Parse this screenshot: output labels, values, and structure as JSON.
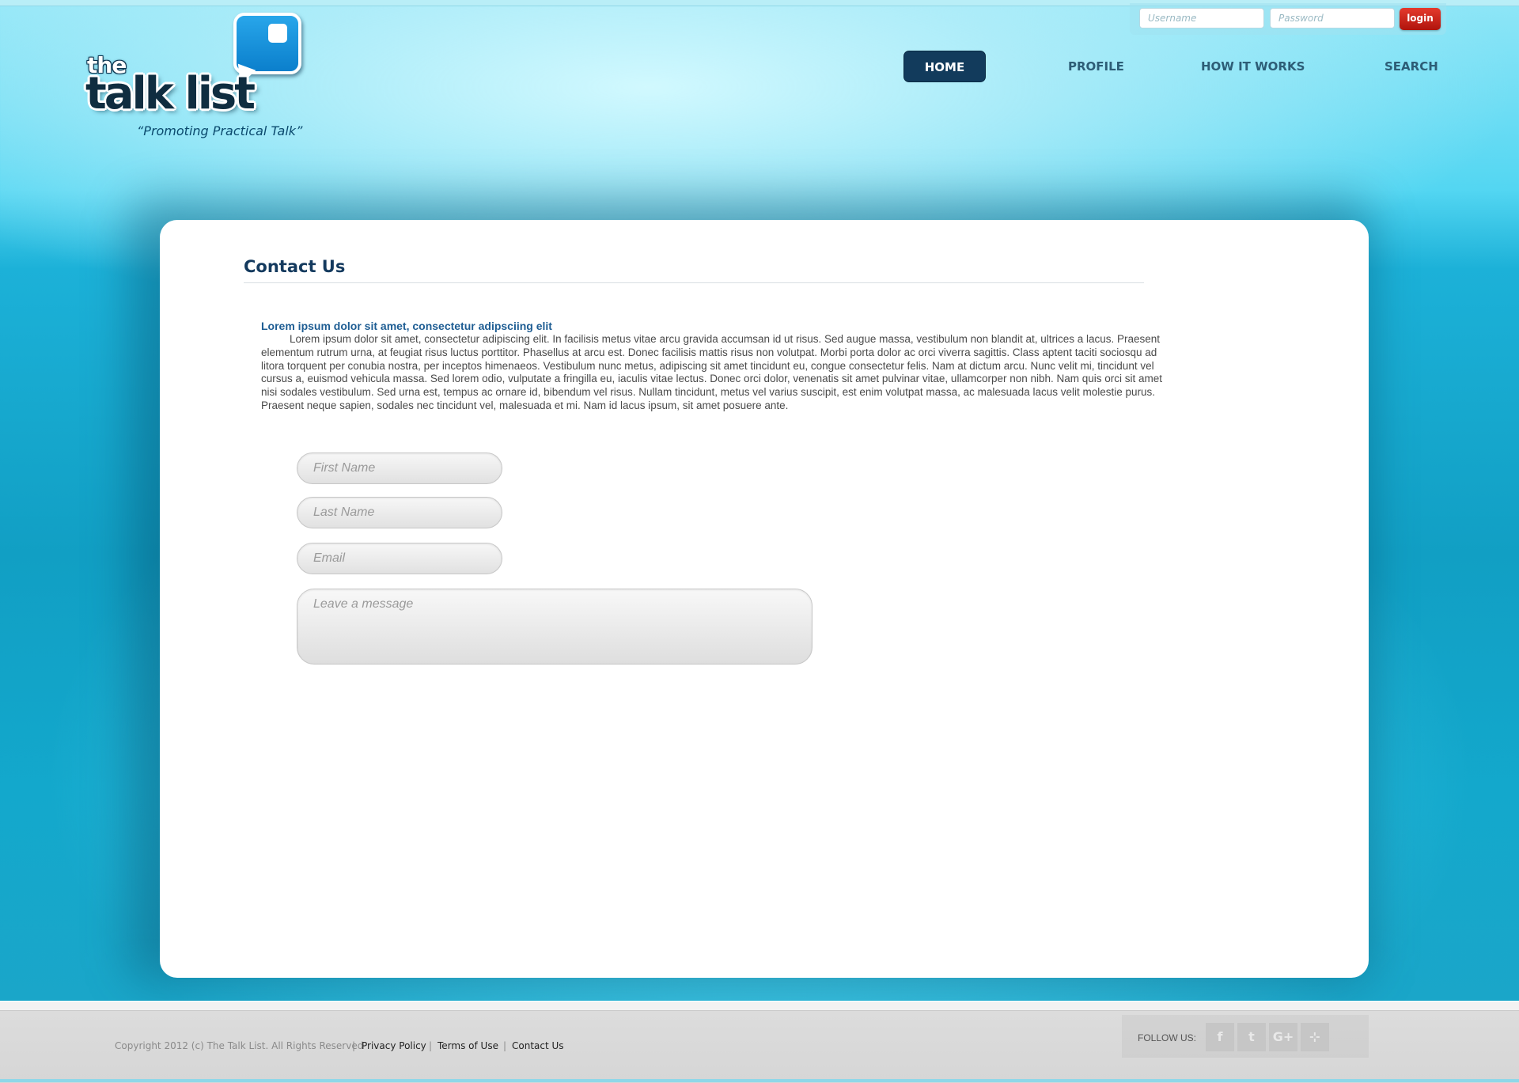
{
  "brand": {
    "logo_small": "the",
    "logo_main": "talk list",
    "tagline": "“Promoting Practical Talk”"
  },
  "login": {
    "username_placeholder": "Username",
    "password_placeholder": "Password",
    "button_label": "login"
  },
  "nav": {
    "items": [
      {
        "label": "HOME",
        "active": true
      },
      {
        "label": "PROFILE"
      },
      {
        "label": "HOW IT WORKS"
      },
      {
        "label": "SEARCH"
      }
    ]
  },
  "main": {
    "title": "Contact Us",
    "lead": "Lorem ipsum dolor sit amet, consectetur adipsciing elit",
    "body": "Lorem ipsum dolor sit amet, consectetur adipiscing elit. In facilisis metus vitae arcu gravida accumsan id ut risus. Sed augue massa, vestibulum non blandit at, ultrices a lacus. Praesent elementum rutrum urna, at feugiat risus luctus porttitor. Phasellus at arcu est. Donec facilisis mattis risus non volutpat. Morbi porta dolor ac orci viverra sagittis. Class aptent taciti sociosqu ad litora torquent per conubia nostra, per inceptos himenaeos. Vestibulum nunc metus, adipiscing sit amet tincidunt eu, congue consectetur felis. Nam at dictum arcu. Nunc velit mi, tincidunt vel cursus a, euismod vehicula massa. Sed lorem odio, vulputate a fringilla eu, iaculis vitae lectus. Donec orci dolor, venenatis sit amet pulvinar vitae, ullamcorper non nibh. Nam quis orci sit amet nisi sodales vestibulum. Sed urna est, tempus ac ornare id, bibendum vel risus. Nullam tincidunt, metus vel varius suscipit, est enim volutpat massa, ac malesuada lacus velit molestie purus. Praesent neque sapien, sodales nec tincidunt vel, malesuada et mi. Nam id lacus ipsum, sit amet posuere ante.",
    "form": {
      "first_name_placeholder": "First Name",
      "last_name_placeholder": "Last Name",
      "email_placeholder": "Email",
      "message_placeholder": "Leave a message"
    }
  },
  "footer": {
    "copyright": "Copyright 2012 (c) The Talk List. All Rights Reserved",
    "separator": "|",
    "links": [
      "Privacy Policy",
      "Terms of Use",
      "Contact Us"
    ],
    "follow_label": "FOLLOW US:",
    "social": [
      {
        "icon": "facebook-icon",
        "glyph": "f"
      },
      {
        "icon": "twitter-icon",
        "glyph": "t"
      },
      {
        "icon": "google-plus-icon",
        "glyph": "G+"
      },
      {
        "icon": "rss-icon",
        "glyph": "⊹"
      }
    ]
  },
  "colors": {
    "accent": "#123b5c",
    "login_button": "#c9201a",
    "title": "#143a5e",
    "lead": "#1e5d93"
  }
}
